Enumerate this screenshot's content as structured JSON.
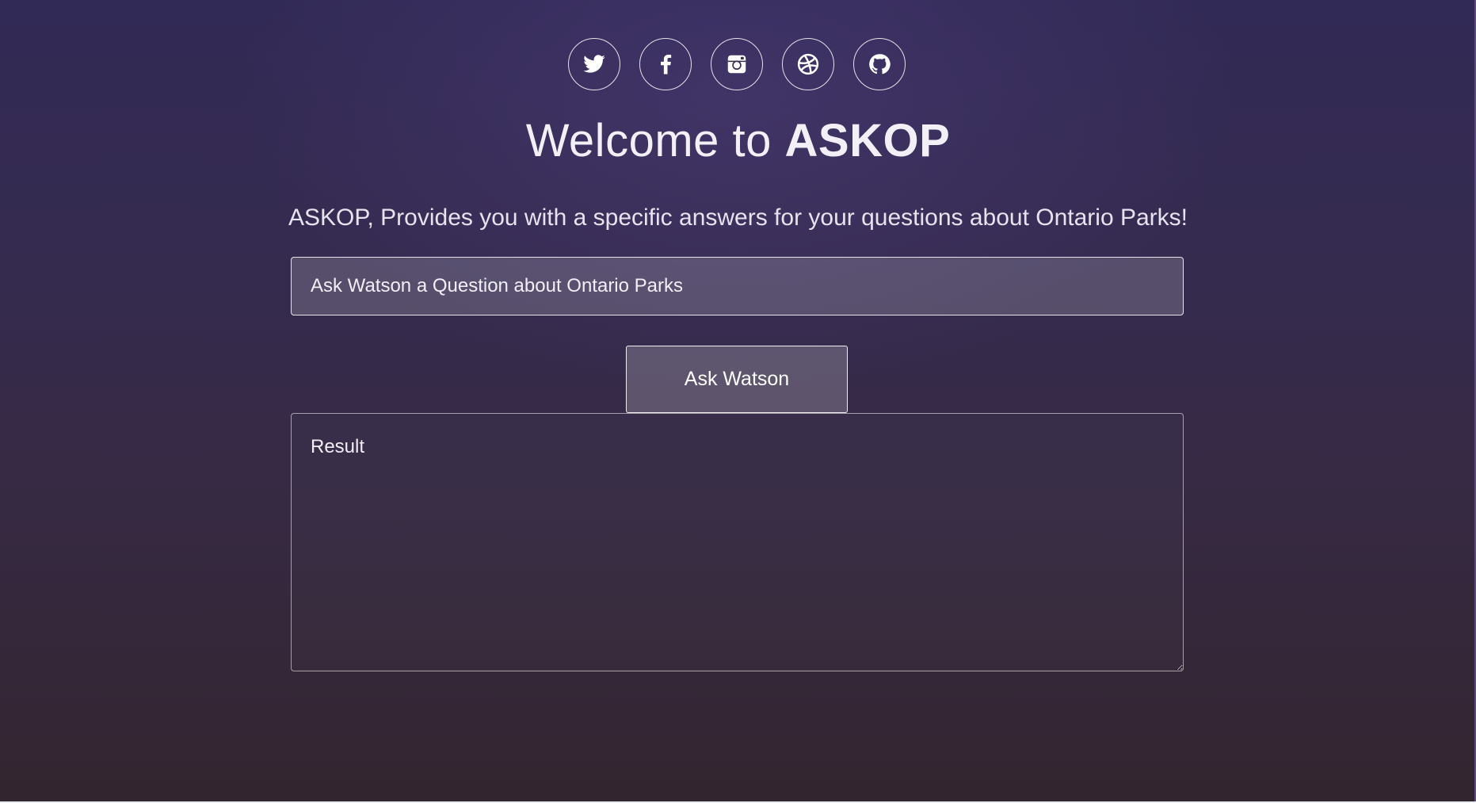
{
  "header": {
    "social_links": [
      {
        "name": "twitter",
        "icon": "twitter-icon"
      },
      {
        "name": "facebook",
        "icon": "facebook-icon"
      },
      {
        "name": "instagram",
        "icon": "instagram-icon"
      },
      {
        "name": "dribbble",
        "icon": "dribbble-icon"
      },
      {
        "name": "github",
        "icon": "github-icon"
      }
    ],
    "title_prefix": "Welcome to ",
    "title_brand": "ASKOP",
    "subtitle": "ASKOP, Provides you with a specific answers for your questions about Ontario Parks!"
  },
  "form": {
    "question_placeholder": "Ask Watson a Question about Ontario Parks",
    "question_value": "",
    "submit_label": "Ask Watson",
    "result_placeholder": "Result",
    "result_value": ""
  },
  "colors": {
    "background_top": "#322a56",
    "background_bottom": "#33252f",
    "text": "#f2f0f6",
    "border": "#ffffff"
  }
}
